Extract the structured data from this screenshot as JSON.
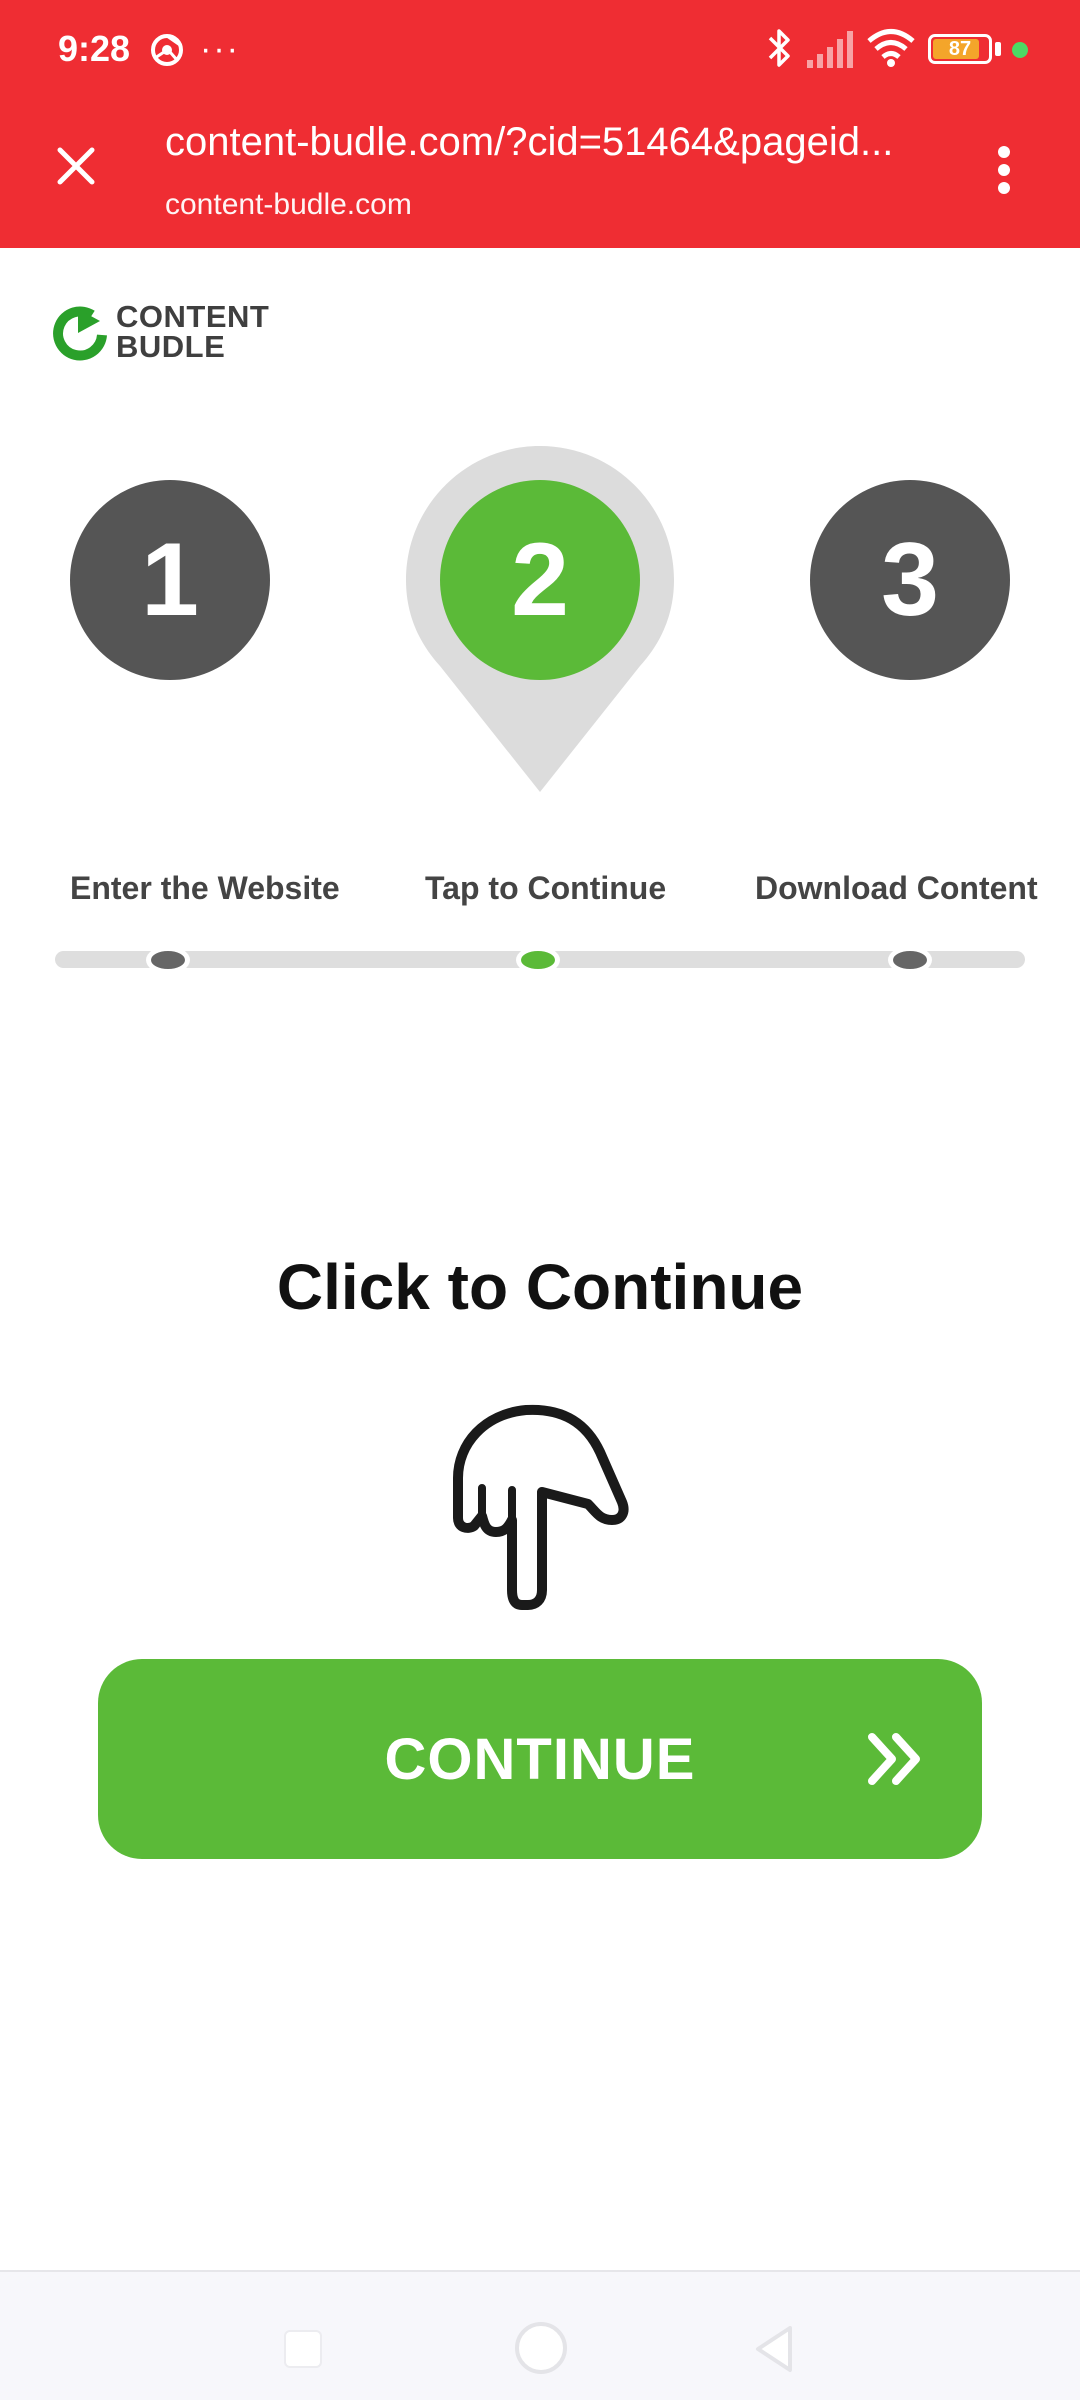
{
  "status_bar": {
    "time": "9:28",
    "more": "···",
    "battery": "87",
    "battery_level": 0.87,
    "icons": [
      "chrome-icon",
      "bluetooth-icon",
      "signal-icon",
      "wifi-icon",
      "battery-icon"
    ]
  },
  "url_bar": {
    "url": "content-budle.com/?cid=51464&pageid...",
    "domain": "content-budle.com",
    "close_icon": "close-icon",
    "menu_icon": "more-vert-icon"
  },
  "logo": {
    "line1": "CONTENT",
    "line2": "BUDLE"
  },
  "steps": [
    {
      "number": "1",
      "label": "Enter the Website"
    },
    {
      "number": "2",
      "label": "Tap to Continue"
    },
    {
      "number": "3",
      "label": "Download Content"
    }
  ],
  "active_step": 2,
  "main": {
    "title": "Click to Continue",
    "button_label": "CONTINUE",
    "button_icon": "double-chevron-right-icon",
    "hand_icon": "pointing-hand-down-icon"
  },
  "colors": {
    "topbar": "#ef2d33",
    "accent_green": "#5bba38",
    "step_gray": "#555555"
  }
}
